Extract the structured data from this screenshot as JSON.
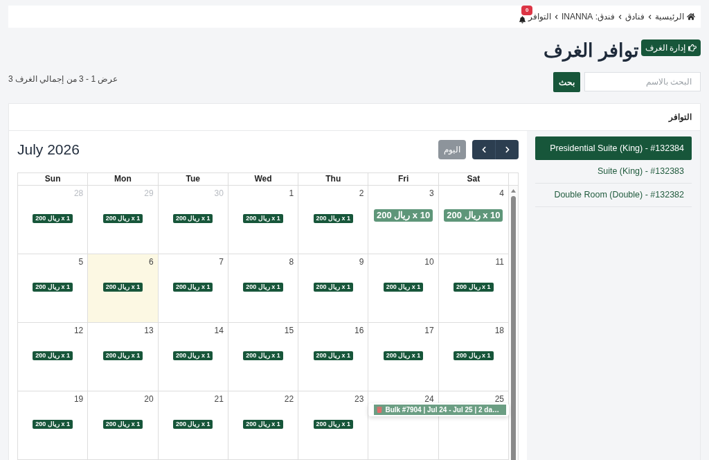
{
  "breadcrumb": {
    "items": [
      {
        "label": "الرئيسية"
      },
      {
        "label": "فنادق"
      },
      {
        "label": "فندق: INANNA"
      },
      {
        "label": "التوافر"
      }
    ],
    "notifications": {
      "count": "0"
    }
  },
  "page_title": "توافر الغرف",
  "manage_button": {
    "label": "إدارة الغرف"
  },
  "search": {
    "placeholder": "البحث بالاسم",
    "button": "بحث"
  },
  "summary": "عرض 1 - 3 من إجمالي الغرف 3",
  "card": {
    "title": "التوافر",
    "calendar": {
      "month_title": "July 2026",
      "today_button": {
        "label": "اليوم",
        "disabled": true
      },
      "weekdays": {
        "sun": "Sun",
        "mon": "Mon",
        "tue": "Tue",
        "wed": "Wed",
        "thu": "Thu",
        "fri": "Fri",
        "sat": "Sat"
      },
      "weeks": [
        {
          "sun": {
            "day": "28",
            "outside": true,
            "today": false,
            "events": [
              {
                "kind": "rate",
                "label": "200 ريال x 1"
              }
            ]
          },
          "mon": {
            "day": "29",
            "outside": true,
            "today": false,
            "events": [
              {
                "kind": "rate",
                "label": "200 ريال x 1"
              }
            ]
          },
          "tue": {
            "day": "30",
            "outside": true,
            "today": false,
            "events": [
              {
                "kind": "rate",
                "label": "200 ريال x 1"
              }
            ]
          },
          "wed": {
            "day": "1",
            "outside": false,
            "today": false,
            "events": [
              {
                "kind": "rate",
                "label": "200 ريال x 1"
              }
            ]
          },
          "thu": {
            "day": "2",
            "outside": false,
            "today": false,
            "events": [
              {
                "kind": "rate",
                "label": "200 ريال x 1"
              }
            ]
          },
          "fri": {
            "day": "3",
            "outside": false,
            "today": false,
            "events": [
              {
                "kind": "bulk_rate",
                "label": "200 ريال x 10"
              }
            ]
          },
          "sat": {
            "day": "4",
            "outside": false,
            "today": false,
            "events": [
              {
                "kind": "bulk_rate",
                "label": "200 ريال x 10"
              }
            ]
          }
        },
        {
          "sun": {
            "day": "5",
            "outside": false,
            "today": false,
            "events": [
              {
                "kind": "rate",
                "label": "200 ريال x 1"
              }
            ]
          },
          "mon": {
            "day": "6",
            "outside": false,
            "today": true,
            "events": [
              {
                "kind": "rate",
                "label": "200 ريال x 1"
              }
            ]
          },
          "tue": {
            "day": "7",
            "outside": false,
            "today": false,
            "events": [
              {
                "kind": "rate",
                "label": "200 ريال x 1"
              }
            ]
          },
          "wed": {
            "day": "8",
            "outside": false,
            "today": false,
            "events": [
              {
                "kind": "rate",
                "label": "200 ريال x 1"
              }
            ]
          },
          "thu": {
            "day": "9",
            "outside": false,
            "today": false,
            "events": [
              {
                "kind": "rate",
                "label": "200 ريال x 1"
              }
            ]
          },
          "fri": {
            "day": "10",
            "outside": false,
            "today": false,
            "events": [
              {
                "kind": "rate",
                "label": "200 ريال x 1"
              }
            ]
          },
          "sat": {
            "day": "11",
            "outside": false,
            "today": false,
            "events": [
              {
                "kind": "rate",
                "label": "200 ريال x 1"
              }
            ]
          }
        },
        {
          "sun": {
            "day": "12",
            "outside": false,
            "today": false,
            "events": [
              {
                "kind": "rate",
                "label": "200 ريال x 1"
              }
            ]
          },
          "mon": {
            "day": "13",
            "outside": false,
            "today": false,
            "events": [
              {
                "kind": "rate",
                "label": "200 ريال x 1"
              }
            ]
          },
          "tue": {
            "day": "14",
            "outside": false,
            "today": false,
            "events": [
              {
                "kind": "rate",
                "label": "200 ريال x 1"
              }
            ]
          },
          "wed": {
            "day": "15",
            "outside": false,
            "today": false,
            "events": [
              {
                "kind": "rate",
                "label": "200 ريال x 1"
              }
            ]
          },
          "thu": {
            "day": "16",
            "outside": false,
            "today": false,
            "events": [
              {
                "kind": "rate",
                "label": "200 ريال x 1"
              }
            ]
          },
          "fri": {
            "day": "17",
            "outside": false,
            "today": false,
            "events": [
              {
                "kind": "rate",
                "label": "200 ريال x 1"
              }
            ]
          },
          "sat": {
            "day": "18",
            "outside": false,
            "today": false,
            "events": [
              {
                "kind": "rate",
                "label": "200 ريال x 1"
              }
            ]
          }
        },
        {
          "sun": {
            "day": "19",
            "outside": false,
            "today": false,
            "events": [
              {
                "kind": "rate",
                "label": "200 ريال x 1"
              }
            ]
          },
          "mon": {
            "day": "20",
            "outside": false,
            "today": false,
            "events": [
              {
                "kind": "rate",
                "label": "200 ريال x 1"
              }
            ]
          },
          "tue": {
            "day": "21",
            "outside": false,
            "today": false,
            "events": [
              {
                "kind": "rate",
                "label": "200 ريال x 1"
              }
            ]
          },
          "wed": {
            "day": "22",
            "outside": false,
            "today": false,
            "events": [
              {
                "kind": "rate",
                "label": "200 ريال x 1"
              }
            ]
          },
          "thu": {
            "day": "23",
            "outside": false,
            "today": false,
            "events": [
              {
                "kind": "rate",
                "label": "200 ريال x 1"
              }
            ]
          },
          "fri": {
            "day": "24",
            "outside": false,
            "today": false,
            "events": [
              {
                "kind": "bulk",
                "label": "Bulk #7904 | Jul 24 - Jul 25 | 2 da…"
              }
            ]
          },
          "sat": {
            "day": "25",
            "outside": false,
            "today": false
          }
        }
      ]
    },
    "rooms": [
      {
        "label": "Presidential Suite (King) - #132384",
        "selected": true
      },
      {
        "label": "Suite (King) - #132383",
        "selected": false
      },
      {
        "label": "Double Room (Double) - #132382",
        "selected": false
      }
    ]
  }
}
